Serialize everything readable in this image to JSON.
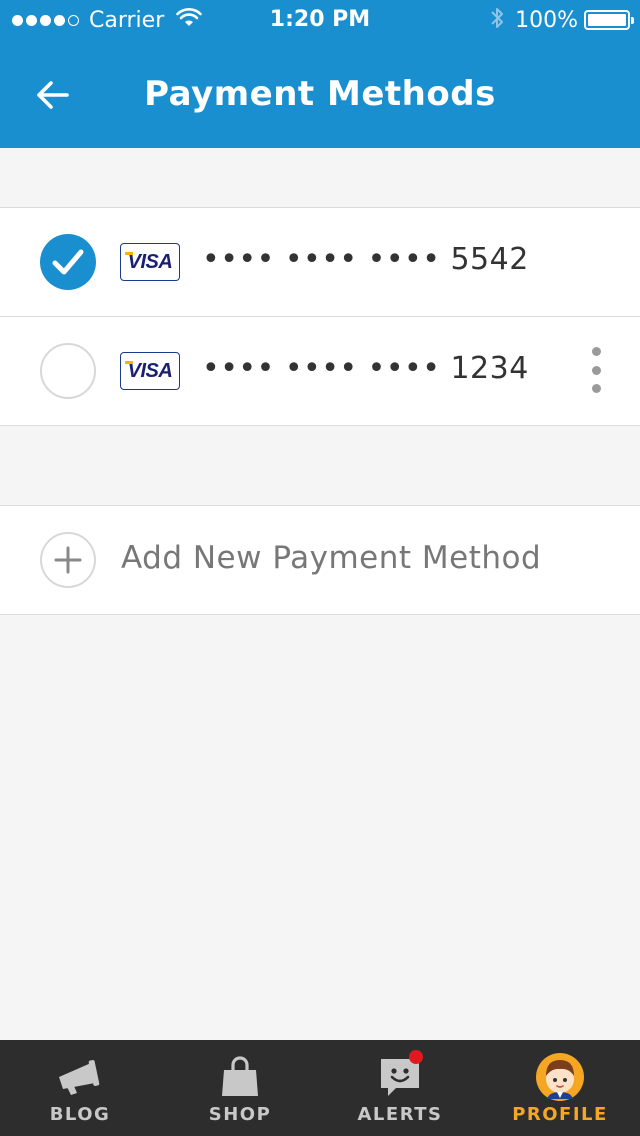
{
  "status_bar": {
    "carrier": "Carrier",
    "time": "1:20 PM",
    "battery": "100%",
    "signal_bars": 4
  },
  "nav": {
    "title": "Payment Methods",
    "back_icon": "arrow-left-icon"
  },
  "cards": [
    {
      "brand": "VISA",
      "masked_number": "•••• •••• •••• 5542",
      "selected": true
    },
    {
      "brand": "VISA",
      "masked_number": "•••• •••• •••• 1234",
      "selected": false
    }
  ],
  "add_payment": {
    "label": "Add New Payment Method",
    "icon": "plus-icon"
  },
  "tabs": [
    {
      "label": "BLOG",
      "icon": "megaphone-icon",
      "active": false
    },
    {
      "label": "SHOP",
      "icon": "shopping-bag-icon",
      "active": false
    },
    {
      "label": "ALERTS",
      "icon": "chat-bubble-icon",
      "active": false,
      "has_badge": true
    },
    {
      "label": "PROFILE",
      "icon": "avatar-icon",
      "active": true
    }
  ],
  "colors": {
    "primary": "#1a8fcf",
    "tab_bar": "#2d2d2d",
    "active_tab": "#f5a623",
    "badge": "#e0191f"
  }
}
